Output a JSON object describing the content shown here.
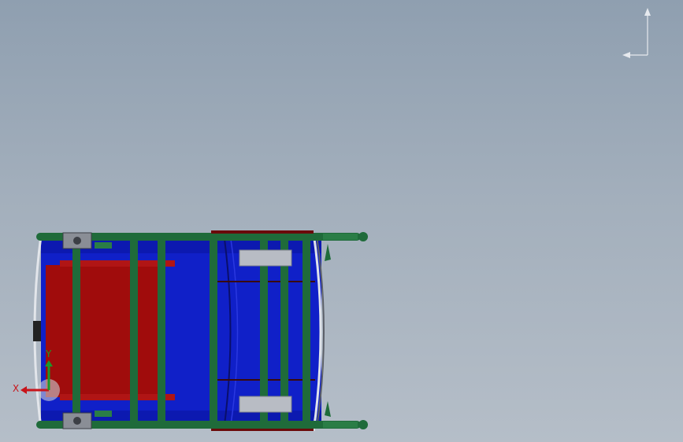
{
  "viewport": {
    "background_top": "#8f9fb0",
    "background_bottom": "#b5bec8"
  },
  "model": {
    "frame_color": "#1f6b3a",
    "frame_highlight": "#3f9a5e",
    "tank_color": "#1020c8",
    "tank_dark": "#06107a",
    "seat_color": "#a00c0c",
    "seat_trim": "#b01515",
    "wheel_color": "#b8bcc4",
    "caster_color": "#6b6f78"
  },
  "triad": {
    "x_label": "X",
    "y_label": "Y",
    "x_color": "#c8141a",
    "y_color": "#1a9a2a"
  },
  "orientation_icon": "view-orientation-icon"
}
